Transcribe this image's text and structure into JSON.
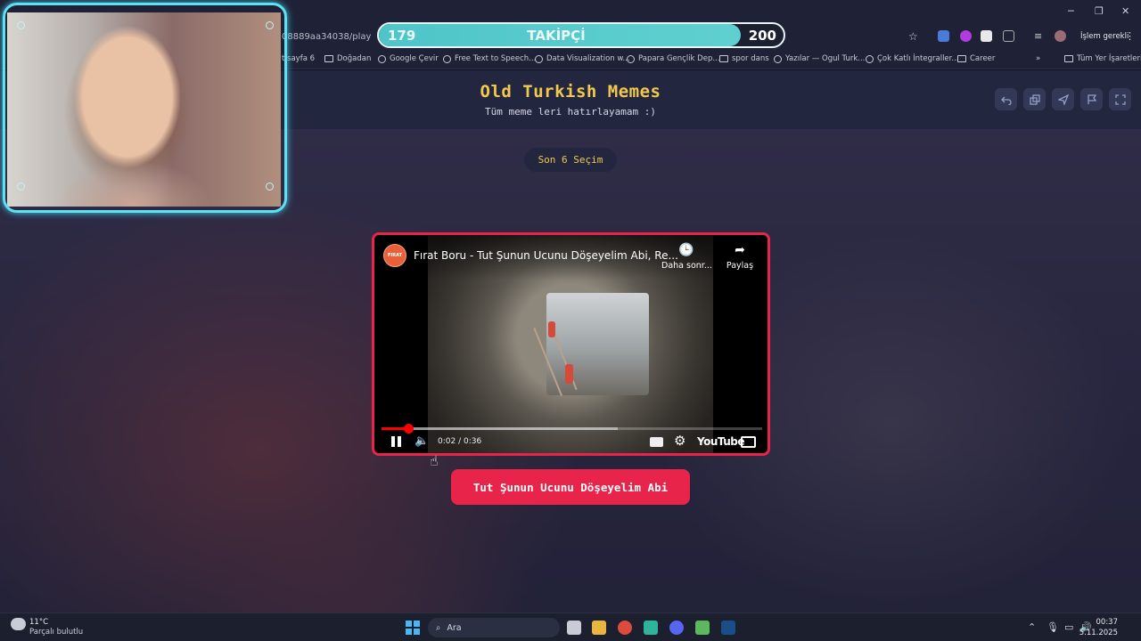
{
  "browser": {
    "url": "08889aa34038/play",
    "bookmarks": [
      {
        "label": "t sayfa 6",
        "type": "page"
      },
      {
        "label": "Doğadan",
        "type": "folder"
      },
      {
        "label": "Google Çevir",
        "type": "page"
      },
      {
        "label": "Free Text to Speech...",
        "type": "page"
      },
      {
        "label": "Data Visualization w...",
        "type": "page"
      },
      {
        "label": "Papara Gençlik Dep...",
        "type": "page"
      },
      {
        "label": "spor dans",
        "type": "folder"
      },
      {
        "label": "Yazılar — Ogul Turk...",
        "type": "page"
      },
      {
        "label": "Çok Katlı İntegraller...",
        "type": "page"
      },
      {
        "label": "Career",
        "type": "folder"
      }
    ],
    "more_bookmarks": "»",
    "all_bookmarks": "Tüm Yer İşaretleri",
    "action_required": "İşlem gerekli",
    "window_controls": [
      "─",
      "❐",
      "✕"
    ]
  },
  "follower_goal": {
    "current": "179",
    "label": "TAKİPÇİ",
    "goal": "200",
    "progress": 0.895
  },
  "page": {
    "title": "Old Turkish Memes",
    "subtitle": "Tüm meme leri hatırlayamam :)",
    "header_icons": [
      "undo-icon",
      "copy-icon",
      "send-icon",
      "flag-icon",
      "fullscreen-icon"
    ],
    "round_label": "Son 6 Seçim"
  },
  "video": {
    "channel_badge": "FIRAT",
    "title": "Fırat Boru - Tut Şunun Ucunu Döşeyelim Abi, Re...",
    "watch_later": "Daha sonr...",
    "share": "Paylaş",
    "time": "0:02 / 0:36",
    "played_fraction": 0.07,
    "buffered_fraction": 0.62,
    "youtube_label": "YouTube"
  },
  "answer_button": "Tut Şunun Ucunu Döşeyelim Abi",
  "taskbar": {
    "weather_temp": "11°C",
    "weather_desc": "Parçalı bulutlu",
    "weather_badge": "1",
    "search_placeholder": "Ara",
    "time": "00:37",
    "date": "5.11.2025"
  },
  "colors": {
    "accent_red": "#e8244a",
    "title_yellow": "#f2c94c",
    "webcam_cyan": "#5ee1f2"
  }
}
